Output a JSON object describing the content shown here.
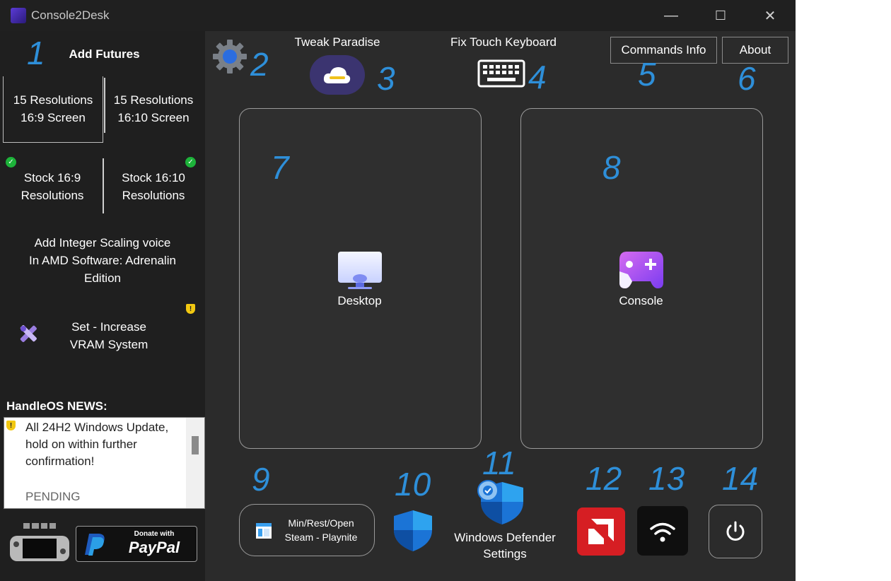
{
  "window": {
    "title": "Console2Desk",
    "minimize": "—",
    "maximize": "☐",
    "close": "✕"
  },
  "sidebar": {
    "add_futures": "Add Futures",
    "res_16_9": [
      "15 Resolutions",
      "16:9 Screen"
    ],
    "res_16_10": [
      "15 Resolutions",
      "16:10 Screen"
    ],
    "stock_16_9": [
      "Stock 16:9",
      "Resolutions"
    ],
    "stock_16_10": [
      "Stock 16:10",
      "Resolutions"
    ],
    "integer_scaling": [
      "Add Integer Scaling voice",
      "In AMD Software: Adrenalin",
      "Edition"
    ],
    "vram": [
      "Set - Increase",
      "VRAM System"
    ],
    "news_title": "HandleOS NEWS:",
    "news_lines": [
      "All 24H2 Windows Update,",
      "hold on within further",
      "confirmation!"
    ],
    "news_status": "PENDING",
    "paypal_small": "Donate with",
    "paypal_big": "PayPal"
  },
  "toolbar": {
    "tweak_paradise": "Tweak Paradise",
    "fix_touch_keyboard": "Fix Touch Keyboard",
    "commands_info": "Commands Info",
    "about": "About"
  },
  "panels": {
    "desktop": "Desktop",
    "console": "Console"
  },
  "bottom": {
    "min_rest_open": [
      "Min/Rest/Open",
      "Steam - Playnite"
    ],
    "defender": [
      "Windows Defender",
      "Settings"
    ]
  },
  "annotations": [
    "1",
    "2",
    "3",
    "4",
    "5",
    "6",
    "7",
    "8",
    "9",
    "10",
    "11",
    "12",
    "13",
    "14"
  ],
  "colors": {
    "accent_number": "#2e8fd9",
    "background": "#2b2b2b",
    "sidebar": "#1f1f1f"
  }
}
